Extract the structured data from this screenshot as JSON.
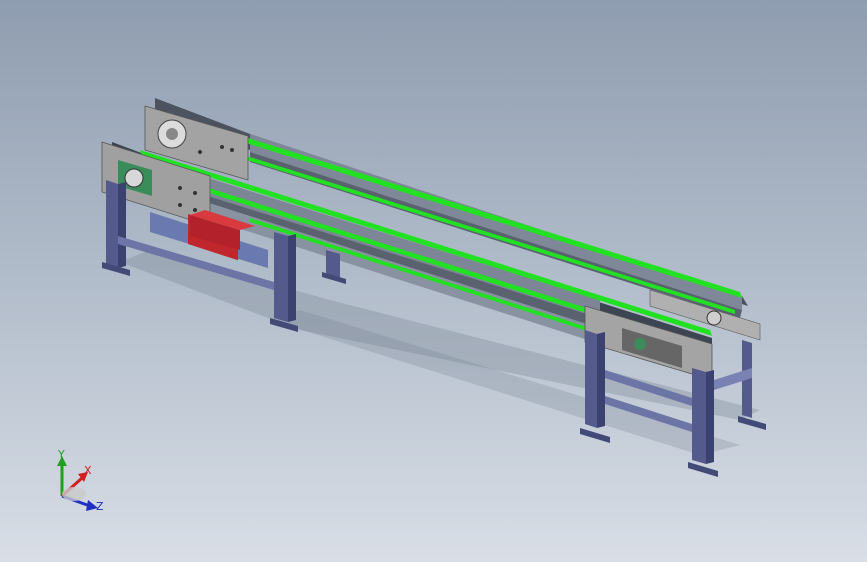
{
  "viewport": {
    "background_top": "#8f9db0",
    "background_bottom": "#d9dee6"
  },
  "model": {
    "belt_color": "#22e022",
    "frame_color": "#6b7383",
    "plate_color": "#9a9a9a",
    "leg_color": "#545b8c",
    "motor_color": "#c0262e",
    "bearing_color": "#3a8d5a"
  },
  "triad": {
    "x_label": "X",
    "y_label": "Y",
    "z_label": "Z",
    "x_color": "#d02020",
    "y_color": "#20a020",
    "z_color": "#2030c0"
  }
}
